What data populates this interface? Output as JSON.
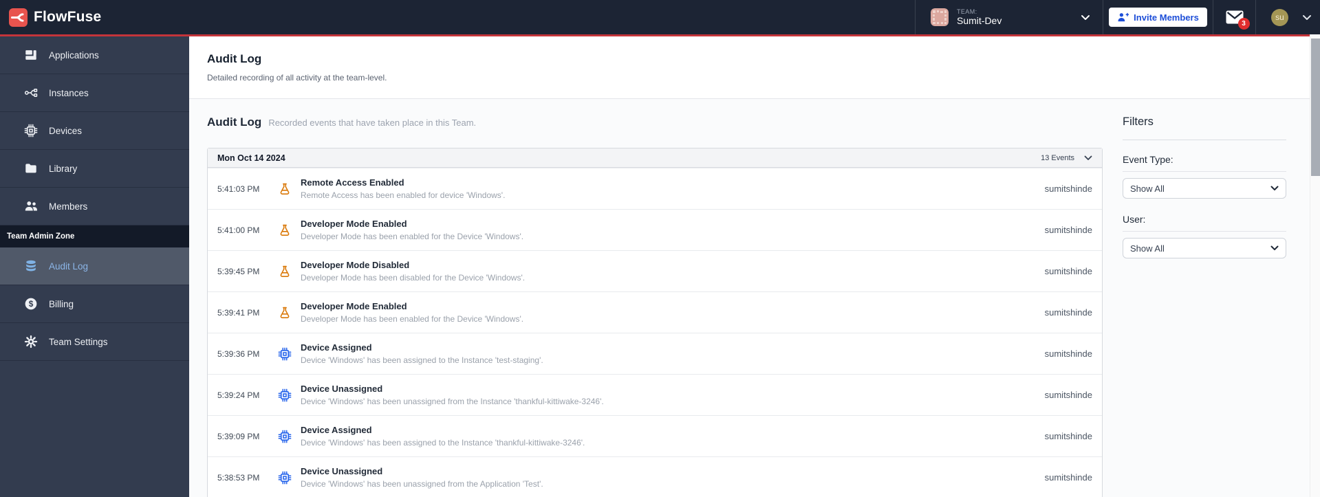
{
  "brand": {
    "name": "FlowFuse"
  },
  "navbar": {
    "team_label": "TEAM:",
    "team_name": "Sumit-Dev",
    "invite_button_label": "Invite Members",
    "notification_count": "3",
    "user_initials": "su"
  },
  "sidebar": {
    "items": [
      {
        "label": "Applications",
        "icon": "applications-icon"
      },
      {
        "label": "Instances",
        "icon": "instances-icon"
      },
      {
        "label": "Devices",
        "icon": "devices-icon"
      },
      {
        "label": "Library",
        "icon": "library-icon"
      },
      {
        "label": "Members",
        "icon": "members-icon"
      }
    ],
    "admin_zone_label": "Team Admin Zone",
    "admin_items": [
      {
        "label": "Audit Log",
        "icon": "database-icon",
        "active": true
      },
      {
        "label": "Billing",
        "icon": "dollar-icon",
        "active": false
      },
      {
        "label": "Team Settings",
        "icon": "gear-icon",
        "active": false
      }
    ]
  },
  "header": {
    "title": "Audit Log",
    "subtitle": "Detailed recording of all activity at the team-level."
  },
  "section": {
    "title": "Audit Log",
    "description": "Recorded events that have taken place in this Team."
  },
  "table": {
    "date": "Mon Oct 14 2024",
    "events_count": "13 Events",
    "rows": [
      {
        "time": "5:41:03 PM",
        "icon": "beaker-icon",
        "title": "Remote Access Enabled",
        "description": "Remote Access has been enabled for device 'Windows'.",
        "user": "sumitshinde"
      },
      {
        "time": "5:41:00 PM",
        "icon": "beaker-icon",
        "title": "Developer Mode Enabled",
        "description": "Developer Mode has been enabled for the Device 'Windows'.",
        "user": "sumitshinde"
      },
      {
        "time": "5:39:45 PM",
        "icon": "beaker-icon",
        "title": "Developer Mode Disabled",
        "description": "Developer Mode has been disabled for the Device 'Windows'.",
        "user": "sumitshinde"
      },
      {
        "time": "5:39:41 PM",
        "icon": "beaker-icon",
        "title": "Developer Mode Enabled",
        "description": "Developer Mode has been enabled for the Device 'Windows'.",
        "user": "sumitshinde"
      },
      {
        "time": "5:39:36 PM",
        "icon": "chip-icon",
        "title": "Device Assigned",
        "description": "Device 'Windows' has been assigned to the Instance 'test-staging'.",
        "user": "sumitshinde"
      },
      {
        "time": "5:39:24 PM",
        "icon": "chip-icon",
        "title": "Device Unassigned",
        "description": "Device 'Windows' has been unassigned from the Instance 'thankful-kittiwake-3246'.",
        "user": "sumitshinde"
      },
      {
        "time": "5:39:09 PM",
        "icon": "chip-icon",
        "title": "Device Assigned",
        "description": "Device 'Windows' has been assigned to the Instance 'thankful-kittiwake-3246'.",
        "user": "sumitshinde"
      },
      {
        "time": "5:38:53 PM",
        "icon": "chip-icon",
        "title": "Device Unassigned",
        "description": "Device 'Windows' has been unassigned from the Application 'Test'.",
        "user": "sumitshinde"
      }
    ]
  },
  "filters": {
    "title": "Filters",
    "event_type_label": "Event Type:",
    "event_type_value": "Show All",
    "user_label": "User:",
    "user_value": "Show All"
  },
  "colors": {
    "navbar_bg": "#1c2434",
    "sidebar_bg": "#333c4f",
    "accent_red": "#c4343a",
    "logo_red": "#e8544e",
    "active_item_blue": "#8cb6e8",
    "invite_blue": "#1d4ed8",
    "badge_red": "#e02d2d",
    "beaker_orange": "#d97706",
    "chip_blue": "#2563eb"
  }
}
